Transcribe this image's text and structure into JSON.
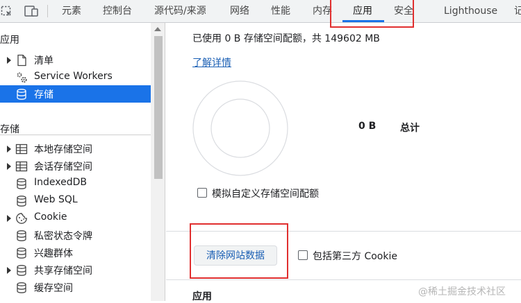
{
  "tabs": {
    "items": [
      "元素",
      "控制台",
      "源代码/来源",
      "网络",
      "性能",
      "内存",
      "应用",
      "安全",
      "Lighthouse",
      "记"
    ],
    "active": "应用"
  },
  "sidebar": {
    "section_app": "应用",
    "app_items": [
      {
        "label": "清单",
        "icon": "document-icon",
        "expandable": true
      },
      {
        "label": "Service Workers",
        "icon": "gears-icon",
        "expandable": false
      },
      {
        "label": "存储",
        "icon": "database-icon",
        "expandable": false,
        "selected": true
      }
    ],
    "section_storage": "存储",
    "storage_items": [
      {
        "label": "本地存储空间",
        "icon": "table-icon",
        "expandable": true
      },
      {
        "label": "会话存储空间",
        "icon": "table-icon",
        "expandable": true
      },
      {
        "label": "IndexedDB",
        "icon": "database-icon",
        "expandable": false
      },
      {
        "label": "Web SQL",
        "icon": "database-icon",
        "expandable": false
      },
      {
        "label": "Cookie",
        "icon": "cookie-icon",
        "expandable": true
      },
      {
        "label": "私密状态令牌",
        "icon": "database-icon",
        "expandable": false
      },
      {
        "label": "兴趣群体",
        "icon": "database-icon",
        "expandable": false
      },
      {
        "label": "共享存储空间",
        "icon": "database-icon",
        "expandable": true
      },
      {
        "label": "缓存空间",
        "icon": "database-icon",
        "expandable": false
      }
    ]
  },
  "main": {
    "usage_text": "已使用 0 B 存储空间配额，共 149602 MB",
    "details_link": "了解详情",
    "chart": {
      "value": "0 B",
      "label": "总计"
    },
    "simulate_quota_label": "模拟自定义存储空间配额",
    "clear_button": "清除网站数据",
    "third_party_cookie_label": "包括第三方 Cookie",
    "bottom_heading": "应用"
  },
  "watermark": "@稀土掘金技术社区"
}
